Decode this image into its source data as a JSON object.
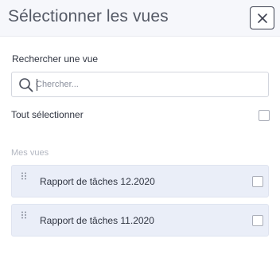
{
  "header": {
    "title": "Sélectionner les vues",
    "close_icon": "close-icon"
  },
  "search": {
    "label": "Rechercher une vue",
    "placeholder": "Chercher...",
    "value": "",
    "icon": "search-icon"
  },
  "select_all": {
    "label": "Tout sélectionner",
    "checked": false
  },
  "section": {
    "label": "Mes vues"
  },
  "views": [
    {
      "label": "Rapport de tâches 12.2020",
      "checked": false,
      "icon": "drag-handle-icon"
    },
    {
      "label": "Rapport de tâches 11.2020",
      "checked": false,
      "icon": "drag-handle-icon"
    }
  ],
  "colors": {
    "header_bg": "#f6f7fb",
    "item_bg": "#eaeef8",
    "text": "#2f3440",
    "muted": "#b3b7c1"
  }
}
